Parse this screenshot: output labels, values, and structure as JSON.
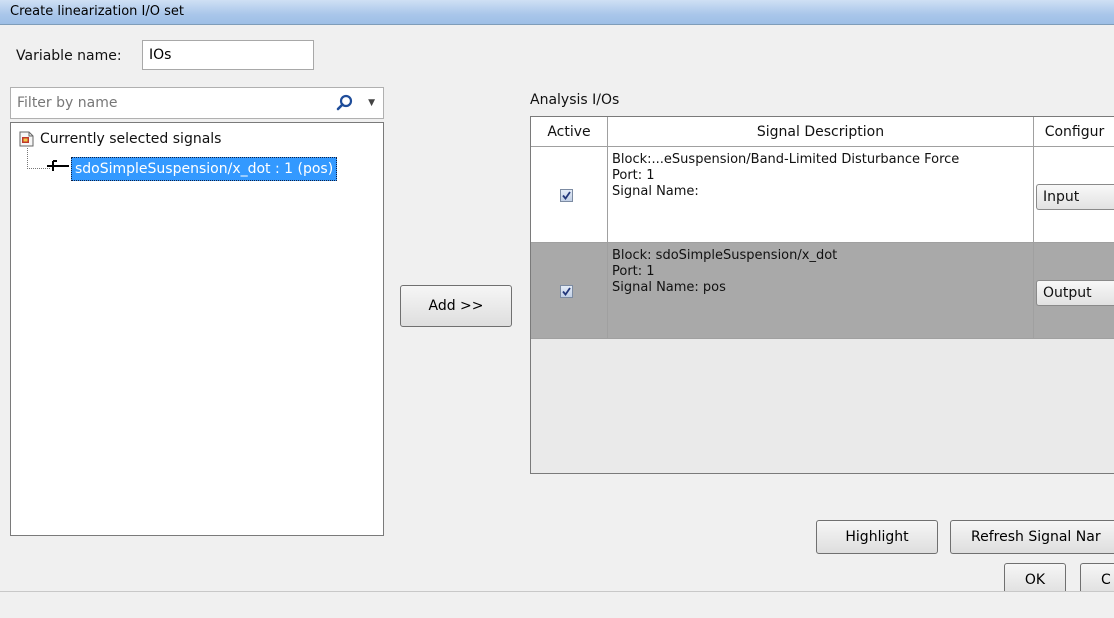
{
  "window": {
    "title": "Create linearization I/O set"
  },
  "variable": {
    "label": "Variable name:",
    "value": "IOs"
  },
  "filter": {
    "placeholder": "Filter by name",
    "search_icon": "search-icon",
    "dropdown_icon": "chevron-down-icon"
  },
  "tree": {
    "root_label": "Currently selected signals",
    "children": [
      "sdoSimpleSuspension/x_dot : 1 (pos)"
    ]
  },
  "add_button": "Add >>",
  "analysis": {
    "label": "Analysis I/Os",
    "columns": [
      "Active",
      "Signal Description",
      "Configur"
    ],
    "rows": [
      {
        "active": true,
        "block": "Block:...eSuspension/Band-Limited Disturbance Force",
        "port": "Port: 1",
        "signal": "Signal Name:",
        "config": "Input",
        "selected": false
      },
      {
        "active": true,
        "block": "Block: sdoSimpleSuspension/x_dot",
        "port": "Port: 1",
        "signal": "Signal Name: pos",
        "config": "Output",
        "selected": true
      }
    ]
  },
  "buttons": {
    "highlight": "Highlight",
    "refresh": "Refresh Signal Nar",
    "ok": "OK",
    "cancel": "C"
  },
  "colors": {
    "selection": "#3399ff",
    "selected_row": "#a9a9a9",
    "titlebar": "#a9c6ea"
  }
}
